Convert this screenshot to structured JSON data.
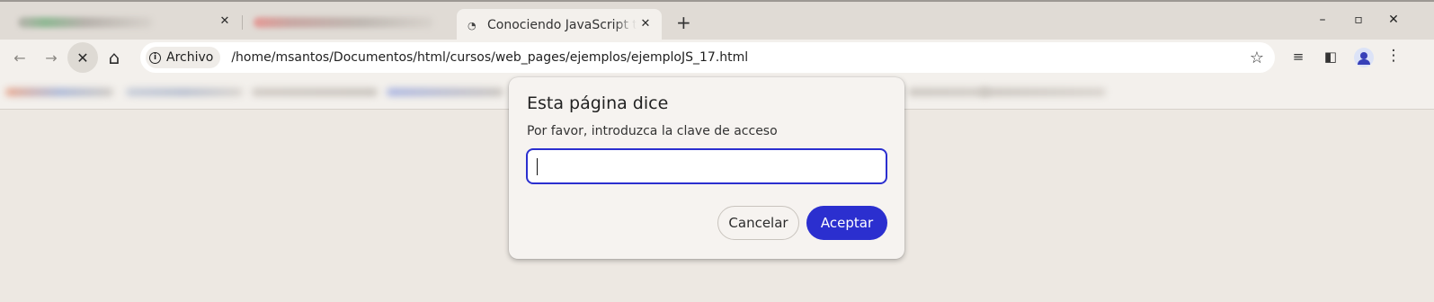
{
  "tabs": {
    "active": {
      "title": "Conociendo JavaScript te",
      "favicon": "page-loading-icon"
    },
    "close_glyph": "✕",
    "new_tab_glyph": "+"
  },
  "window_controls": {
    "minimize": "–",
    "maximize": "▫",
    "close": "✕"
  },
  "toolbar": {
    "back_icon": "←",
    "forward_icon": "→",
    "stop_icon": "✕",
    "home_icon": "⌂",
    "security_chip_label": "Archivo",
    "security_icon": "i",
    "url": "/home/msantos/Documentos/html/cursos/web_pages/ejemplos/ejemploJS_17.html",
    "bookmark_icon": "☆",
    "media_icon": "≡",
    "sidepanel_icon": "◧",
    "menu_icon": "⋮"
  },
  "dialog": {
    "title": "Esta página dice",
    "message": "Por favor, introduzca la clave de acceso",
    "input_value": "",
    "cancel_label": "Cancelar",
    "ok_label": "Aceptar"
  },
  "colors": {
    "accent": "#2b2fcf",
    "page_background": "#ede8e2",
    "chrome_background": "#f3f0ec"
  }
}
